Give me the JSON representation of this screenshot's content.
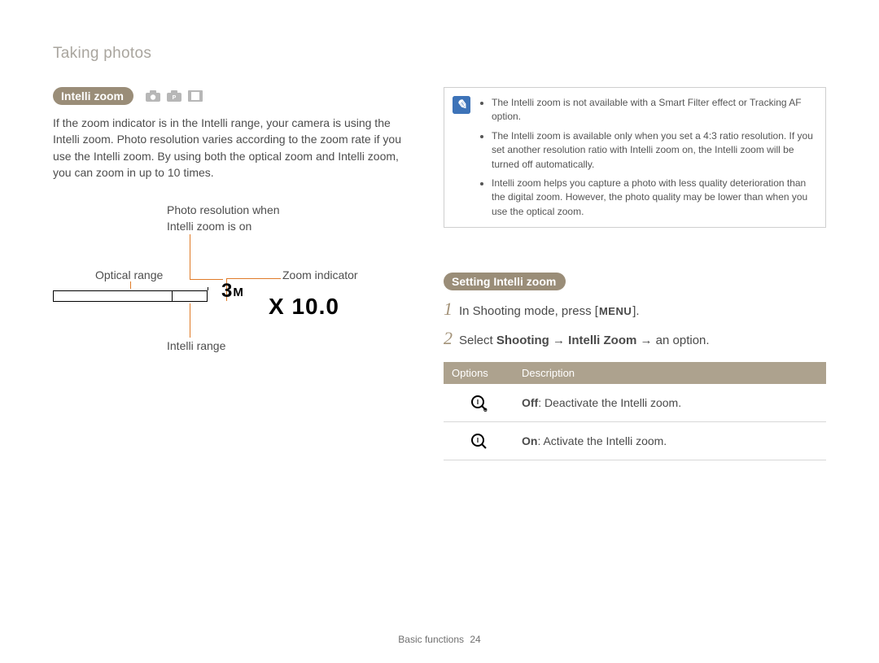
{
  "header": {
    "section": "Taking photos"
  },
  "left": {
    "heading_pill": "Intelli zoom",
    "body": "If the zoom indicator is in the Intelli range, your camera is using the Intelli zoom. Photo resolution varies according to the zoom rate if you use the Intelli zoom. By using both the optical zoom and Intelli zoom, you can zoom in up to 10 times.",
    "labels": {
      "photo_res_line1": "Photo resolution when",
      "photo_res_line2": "Intelli zoom is on",
      "optical_range": "Optical range",
      "zoom_indicator": "Zoom indicator",
      "intelli_range": "Intelli range"
    },
    "zoom_3m": "3",
    "zoom_3m_suffix": "M",
    "zoom_value": "X 10.0"
  },
  "right": {
    "notes": [
      "The Intelli zoom is not available with a Smart Filter effect or Tracking AF option.",
      "The Intelli zoom is available only when you set a 4:3 ratio resolution. If you set another resolution ratio with Intelli zoom on, the Intelli zoom will be turned off automatically.",
      "Intelli zoom helps you capture a photo with less quality deterioration than the digital zoom. However, the photo quality may be lower than when you use the optical zoom."
    ],
    "setting_pill": "Setting Intelli zoom",
    "steps": [
      {
        "n": "1",
        "prefix": "In Shooting mode, press [",
        "menu": "MENU",
        "suffix": "]."
      },
      {
        "n": "2",
        "prefix": "Select ",
        "bold": "Shooting → Intelli Zoom",
        "suffix": " → an option."
      }
    ],
    "table": {
      "col1": "Options",
      "col2": "Description",
      "rows": [
        {
          "bold": "Off",
          "rest": ": Deactivate the Intelli zoom."
        },
        {
          "bold": "On",
          "rest": ": Activate the Intelli zoom."
        }
      ]
    }
  },
  "footer": {
    "label": "Basic functions",
    "page": "24"
  }
}
